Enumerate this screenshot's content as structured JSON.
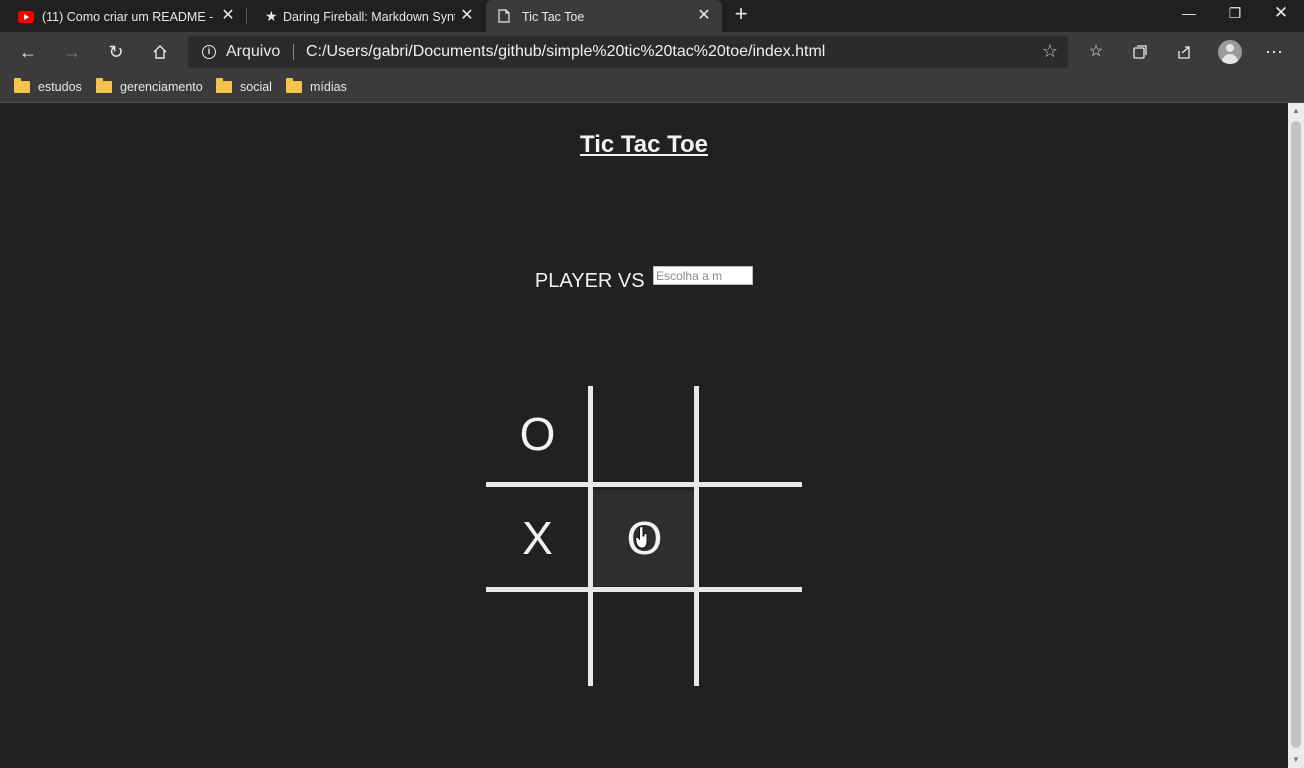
{
  "tabs": [
    {
      "title": "(11) Como criar um README - Yo",
      "icon": "youtube-icon"
    },
    {
      "title": "Daring Fireball: Markdown Synta",
      "icon": "star-icon"
    },
    {
      "title": "Tic Tac Toe",
      "icon": "page-icon"
    }
  ],
  "toolbar": {
    "scheme": "Arquivo",
    "url": "C:/Users/gabri/Documents/github/simple%20tic%20tac%20toe/index.html"
  },
  "bookmarks": [
    {
      "label": "estudos"
    },
    {
      "label": "gerenciamento"
    },
    {
      "label": "social"
    },
    {
      "label": "mídias"
    }
  ],
  "page": {
    "title": "Tic Tac Toe",
    "player_label": "PLAYER VS",
    "mode_placeholder": "Escolha a m",
    "board": {
      "cells": [
        "O",
        "",
        "",
        "X",
        "O",
        "",
        "",
        "",
        ""
      ],
      "hovered_cell": 4
    }
  },
  "colors": {
    "page_background": "#212121",
    "text": "#f2f2f2",
    "grid_lines": "#e8e8e8",
    "hover_cell": "#2e2e2e",
    "chrome_background": "#3b3b3b"
  }
}
